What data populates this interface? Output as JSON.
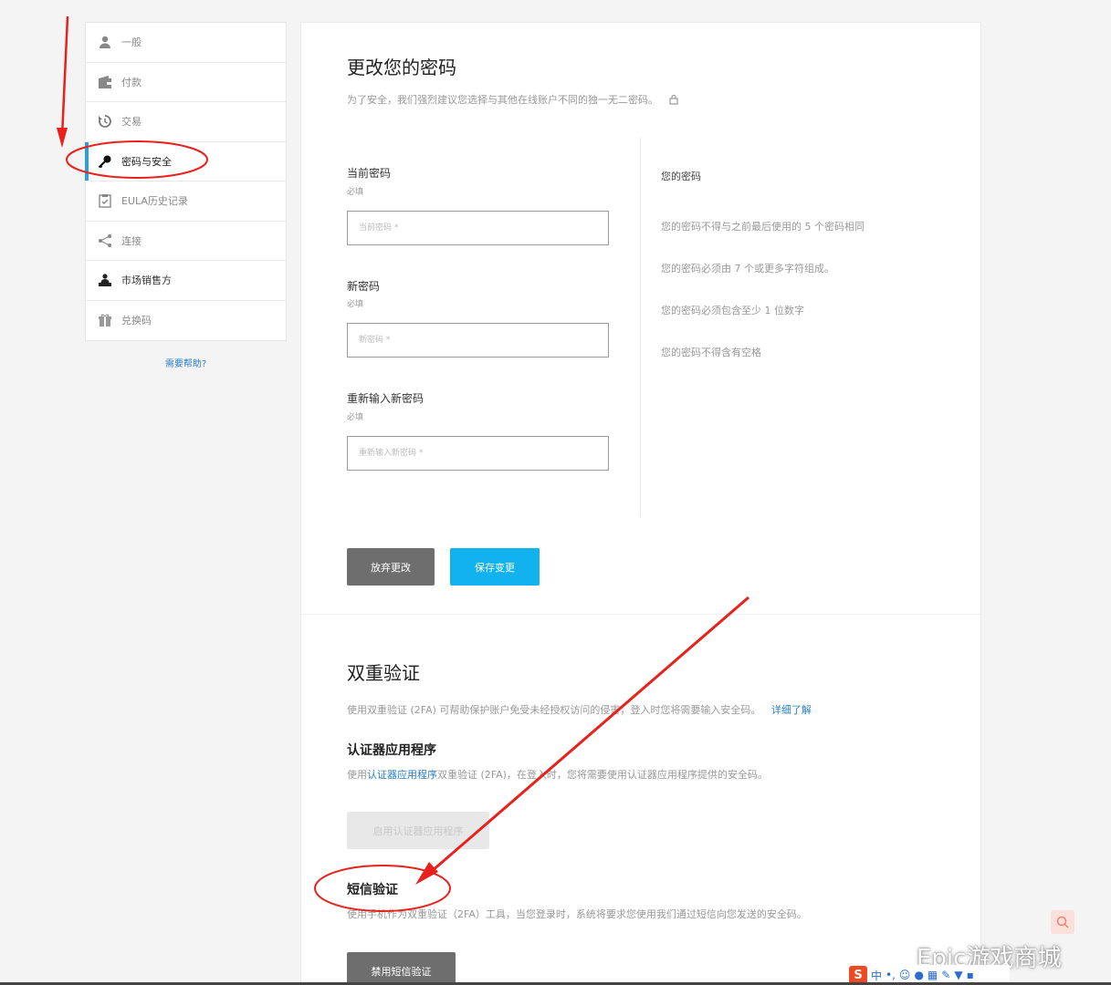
{
  "sidebar": {
    "items": [
      {
        "label": "一般",
        "icon": "person-icon"
      },
      {
        "label": "付款",
        "icon": "wallet-icon"
      },
      {
        "label": "交易",
        "icon": "history-icon"
      },
      {
        "label": "密码与安全",
        "icon": "key-icon"
      },
      {
        "label": "EULA历史记录",
        "icon": "clipboard-check-icon"
      },
      {
        "label": "连接",
        "icon": "share-icon"
      },
      {
        "label": "市场销售方",
        "icon": "seller-icon"
      },
      {
        "label": "兑换码",
        "icon": "gift-icon"
      }
    ],
    "help": "需要帮助?"
  },
  "password": {
    "title": "更改您的密码",
    "subtitle": "为了安全，我们强烈建议您选择与其他在线账户不同的独一无二密码。",
    "fields": [
      {
        "label": "当前密码",
        "required": "必填",
        "placeholder": "当前密码 *"
      },
      {
        "label": "新密码",
        "required": "必填",
        "placeholder": "新密码 *"
      },
      {
        "label": "重新输入新密码",
        "required": "必填",
        "placeholder": "重新输入新密码 *"
      }
    ],
    "rules_title": "您的密码",
    "rules": [
      "您的密码不得与之前最后使用的 5 个密码相同",
      "您的密码必须由 7 个或更多字符组成。",
      "您的密码必须包含至少 1 位数字",
      "您的密码不得含有空格"
    ],
    "discard_label": "放弃更改",
    "save_label": "保存变更"
  },
  "twofa": {
    "title": "双重验证",
    "desc": "使用双重验证 (2FA) 可帮助保护账户免受未经授权访问的侵害，登入时您将需要输入安全码。",
    "learn_more": "详细了解",
    "auth_title": "认证器应用程序",
    "auth_desc_pre": "使用",
    "auth_desc_link": "认证器应用程序",
    "auth_desc_post": "双重验证 (2FA)，在登入时，您将需要使用认证器应用程序提供的安全码。",
    "auth_button": "启用认证器应用程序",
    "sms_title": "短信验证",
    "sms_desc": "使用手机作为双重验证（2FA）工具，当您登录时，系统将要求您使用我们通过短信向您发送的安全码。",
    "sms_button": "禁用短信验证"
  },
  "watermark": {
    "text": "Epic游戏商城"
  },
  "tray": {
    "ime": "中"
  },
  "colors": {
    "accent": "#11b2ee",
    "active_bar": "#2aa0e0",
    "annotation": "#e8211c",
    "link": "#2a7fc6"
  }
}
